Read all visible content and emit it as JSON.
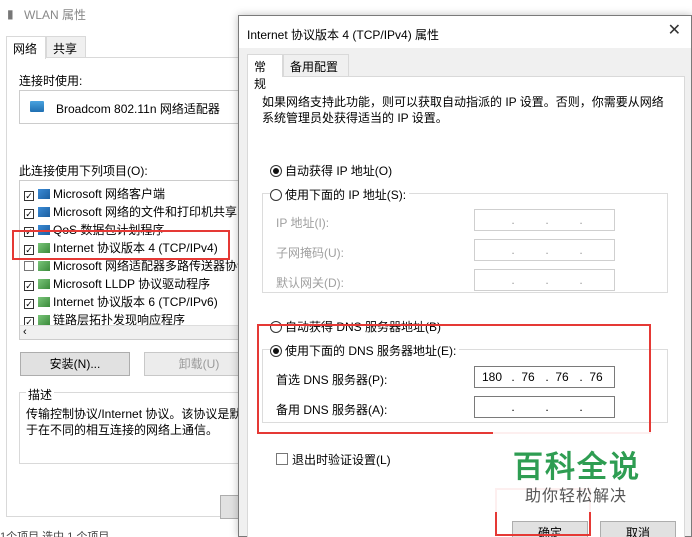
{
  "wlan": {
    "title": "WLAN 属性",
    "tabs": [
      "网络",
      "共享"
    ],
    "connect_using_label": "连接时使用:",
    "adapter_name": "Broadcom 802.11n 网络适配器",
    "items_label": "此连接使用下列项目(O):",
    "items": [
      {
        "checked": true,
        "label": "Microsoft 网络客户端"
      },
      {
        "checked": true,
        "label": "Microsoft 网络的文件和打印机共享"
      },
      {
        "checked": true,
        "label": "QoS 数据包计划程序"
      },
      {
        "checked": true,
        "label": "Internet 协议版本 4 (TCP/IPv4)"
      },
      {
        "checked": false,
        "label": "Microsoft 网络适配器多路传送器协议"
      },
      {
        "checked": true,
        "label": "Microsoft LLDP 协议驱动程序"
      },
      {
        "checked": true,
        "label": "Internet 协议版本 6 (TCP/IPv6)"
      },
      {
        "checked": true,
        "label": "链路层拓扑发现响应程序"
      }
    ],
    "install_label": "安装(N)...",
    "uninstall_label": "卸载(U)",
    "description_title": "描述",
    "description_text_1": "传输控制协议/Internet 协议。该协议是默",
    "description_text_2": "于在不同的相互连接的网络上通信。",
    "status_bar": "1个项目    选中 1 个项目"
  },
  "dialog": {
    "title": "Internet 协议版本 4 (TCP/IPv4) 属性",
    "tabs": [
      "常规",
      "备用配置"
    ],
    "info_line_1": "如果网络支持此功能，则可以获取自动指派的 IP 设置。否则，你需要从网络",
    "info_line_2": "系统管理员处获得适当的 IP 设置。",
    "auto_ip_label": "自动获得 IP 地址(O)",
    "manual_ip_label": "使用下面的 IP 地址(S):",
    "ip_address_label": "IP 地址(I):",
    "subnet_label": "子网掩码(U):",
    "gateway_label": "默认网关(D):",
    "auto_dns_label": "自动获得 DNS 服务器地址(B)",
    "manual_dns_label": "使用下面的 DNS 服务器地址(E):",
    "preferred_dns_label": "首选 DNS 服务器(P):",
    "preferred_dns_value": [
      "180",
      "76",
      "76",
      "76"
    ],
    "alternate_dns_label": "备用 DNS 服务器(A):",
    "validate_label": "退出时验证设置(L)",
    "ok_label": "确定",
    "cancel_label": "取消"
  },
  "watermark": {
    "title": "百科全说",
    "subtitle": "助你轻松解决"
  },
  "colors": {
    "highlight_red": "#e53935",
    "watermark_green": "#2e9d52"
  }
}
